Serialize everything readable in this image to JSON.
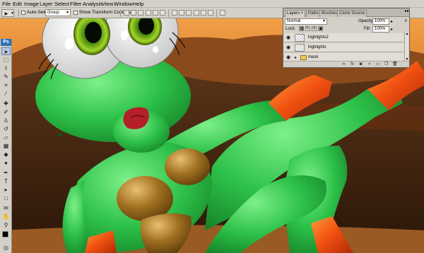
{
  "menubar": {
    "items": [
      "File",
      "Edit",
      "Image",
      "Layer",
      "Select",
      "Filter",
      "Analysis",
      "View",
      "Window",
      "Help"
    ]
  },
  "options_bar": {
    "tool_icon": "move-tool-icon",
    "auto_select_label": "Auto-Select:",
    "auto_select_value": "Group",
    "transform_label": "Show Transform Controls"
  },
  "toolbox": {
    "logo": "Ps",
    "tools": [
      "move",
      "marquee",
      "lasso",
      "quick-selection",
      "crop",
      "eyedropper",
      "healing-brush",
      "brush",
      "clone-stamp",
      "history-brush",
      "eraser",
      "gradient",
      "blur",
      "dodge",
      "pen",
      "type",
      "path-selection",
      "shape",
      "notes",
      "hand",
      "zoom"
    ],
    "foreground_color": "#000000",
    "background_color": "#ffffff"
  },
  "layers_panel": {
    "tabs": [
      "Layers",
      "Paths",
      "Brushes",
      "Clone Source"
    ],
    "active_tab": "Layers",
    "close_glyph": "×",
    "blend_mode": "Normal",
    "opacity_label": "Opacity:",
    "opacity_value": "100%",
    "lock_label": "Lock:",
    "fill_label": "Fill:",
    "fill_value": "100%",
    "layers": [
      {
        "name": "highlights2",
        "visible": true,
        "type": "layer"
      },
      {
        "name": "highlights",
        "visible": true,
        "type": "layer"
      },
      {
        "name": "mask",
        "visible": true,
        "type": "group"
      }
    ]
  },
  "colors": {
    "ui_chrome": "#d4d0c8",
    "frog_green": "#2ec24a",
    "sky_orange": "#e07820",
    "lips_red": "#b42028"
  }
}
